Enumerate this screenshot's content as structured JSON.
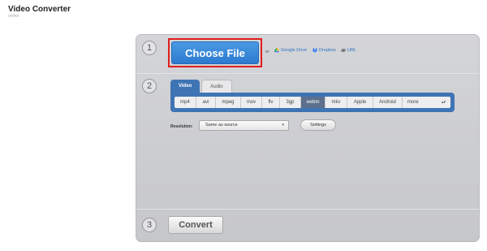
{
  "app": {
    "title": "Video Converter",
    "subtitle": "online"
  },
  "steps": {
    "one": "1",
    "two": "2",
    "three": "3"
  },
  "source": {
    "choose_file": "Choose File",
    "or": "or",
    "links": [
      {
        "label": "Google Drive",
        "icon": "google-drive-icon",
        "color": "#2b6fc4"
      },
      {
        "label": "Dropbox",
        "icon": "dropbox-icon",
        "color": "#2b6fc4"
      },
      {
        "label": "URL",
        "icon": "link-icon",
        "color": "#2b6fc4"
      }
    ]
  },
  "tabs": [
    {
      "label": "Video",
      "active": true
    },
    {
      "label": "Audio",
      "active": false
    }
  ],
  "formats": [
    "mp4",
    "avi",
    "mpeg",
    "mov",
    "flv",
    "3gp",
    "webm",
    "mkv",
    "Apple",
    "Android",
    "more"
  ],
  "selected_format": "webm",
  "resolution": {
    "label": "Resolution:",
    "value": "Same as source"
  },
  "settings_label": "Settings",
  "convert_label": "Convert",
  "colors": {
    "accent": "#3f74b4",
    "choose_button": "#3a8ad9",
    "highlight": "#e11d1d",
    "link": "#2b6fc4"
  }
}
